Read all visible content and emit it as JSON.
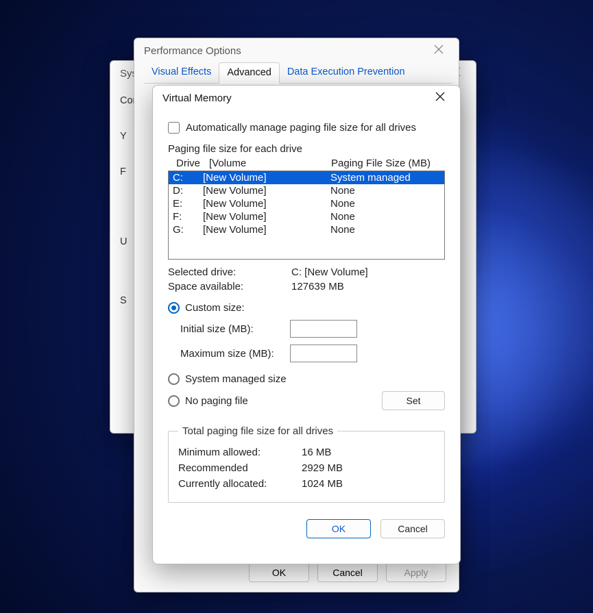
{
  "system_dialog": {
    "title": "Syste",
    "side_items": [
      "Com",
      "Y",
      "F",
      "U",
      "S"
    ]
  },
  "perf_dialog": {
    "title": "Performance Options",
    "tabs": [
      {
        "label": "Visual Effects"
      },
      {
        "label": "Advanced"
      },
      {
        "label": "Data Execution Prevention"
      }
    ],
    "footer": {
      "ok": "OK",
      "cancel": "Cancel",
      "apply": "Apply"
    }
  },
  "vmem": {
    "title": "Virtual Memory",
    "auto_checkbox_label": "Automatically manage paging file size for all drives",
    "group_label": "Paging file size for each drive",
    "headers": {
      "drive": "Drive",
      "volume": "[Volume",
      "pfs": "Paging File Size (MB)"
    },
    "drives": [
      {
        "letter": "C:",
        "volume": "[New Volume]",
        "pfs": "System managed",
        "selected": true
      },
      {
        "letter": "D:",
        "volume": "[New Volume]",
        "pfs": "None",
        "selected": false
      },
      {
        "letter": "E:",
        "volume": "[New Volume]",
        "pfs": "None",
        "selected": false
      },
      {
        "letter": "F:",
        "volume": "[New Volume]",
        "pfs": "None",
        "selected": false
      },
      {
        "letter": "G:",
        "volume": "[New Volume]",
        "pfs": "None",
        "selected": false
      }
    ],
    "selected_drive_label": "Selected drive:",
    "selected_drive_value": "C:  [New Volume]",
    "space_label": "Space available:",
    "space_value": "127639 MB",
    "radio_custom": "Custom size:",
    "initial_label": "Initial size (MB):",
    "initial_value": "",
    "max_label": "Maximum size (MB):",
    "max_value": "",
    "radio_system": "System managed size",
    "radio_none": "No paging file",
    "set_button": "Set",
    "totals_legend": "Total paging file size for all drives",
    "totals": {
      "min_label": "Minimum allowed:",
      "min_value": "16 MB",
      "rec_label": "Recommended",
      "rec_value": "2929 MB",
      "cur_label": "Currently allocated:",
      "cur_value": "1024 MB"
    },
    "footer": {
      "ok": "OK",
      "cancel": "Cancel"
    }
  }
}
